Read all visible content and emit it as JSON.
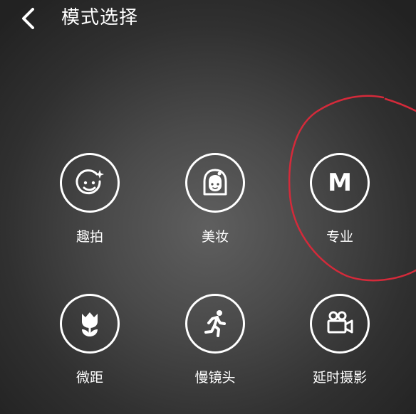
{
  "header": {
    "title": "模式选择",
    "back_icon": "chevron-left-icon"
  },
  "modes": [
    {
      "label": "趣拍",
      "icon": "smiley-sparkle-icon"
    },
    {
      "label": "美妆",
      "icon": "woman-face-icon"
    },
    {
      "label": "专业",
      "icon": "m-letter-icon",
      "glyph": "M"
    },
    {
      "label": "微距",
      "icon": "tulip-icon"
    },
    {
      "label": "慢镜头",
      "icon": "running-person-icon"
    },
    {
      "label": "延时摄影",
      "icon": "video-camera-icon"
    }
  ],
  "colors": {
    "background": "#4a4a4a",
    "foreground": "#ffffff",
    "annotation": "#d42a3a"
  }
}
